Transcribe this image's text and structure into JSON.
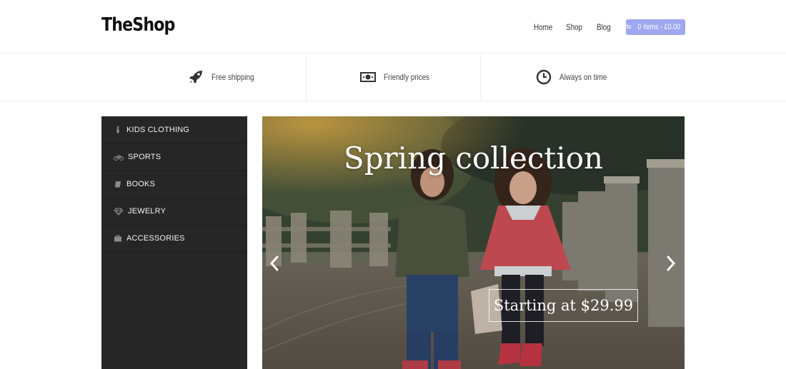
{
  "header": {
    "logo": "TheShop",
    "nav": [
      {
        "label": "Home"
      },
      {
        "label": "Shop"
      },
      {
        "label": "Blog"
      }
    ],
    "cart_label": "0 items - £0.00",
    "cart_color": "#9ea7f0",
    "cart_icon": "shopping-cart-icon"
  },
  "features": [
    {
      "label": "Free shipping",
      "icon": "rocket-icon"
    },
    {
      "label": "Friendly prices",
      "icon": "banknote-icon"
    },
    {
      "label": "Always on time",
      "icon": "clock-icon"
    }
  ],
  "sidebar": {
    "items": [
      {
        "label": "KIDS CLOTHING",
        "icon": "tie-icon"
      },
      {
        "label": "SPORTS",
        "icon": "bicycle-icon"
      },
      {
        "label": "BOOKS",
        "icon": "book-icon"
      },
      {
        "label": "JEWELRY",
        "icon": "diamond-icon"
      },
      {
        "label": "ACCESSORIES",
        "icon": "briefcase-icon"
      }
    ],
    "background": "#262626"
  },
  "hero": {
    "title": "Spring collection",
    "price_tag": "Starting at $29.99",
    "prev_icon": "chevron-left-icon",
    "next_icon": "chevron-right-icon"
  }
}
